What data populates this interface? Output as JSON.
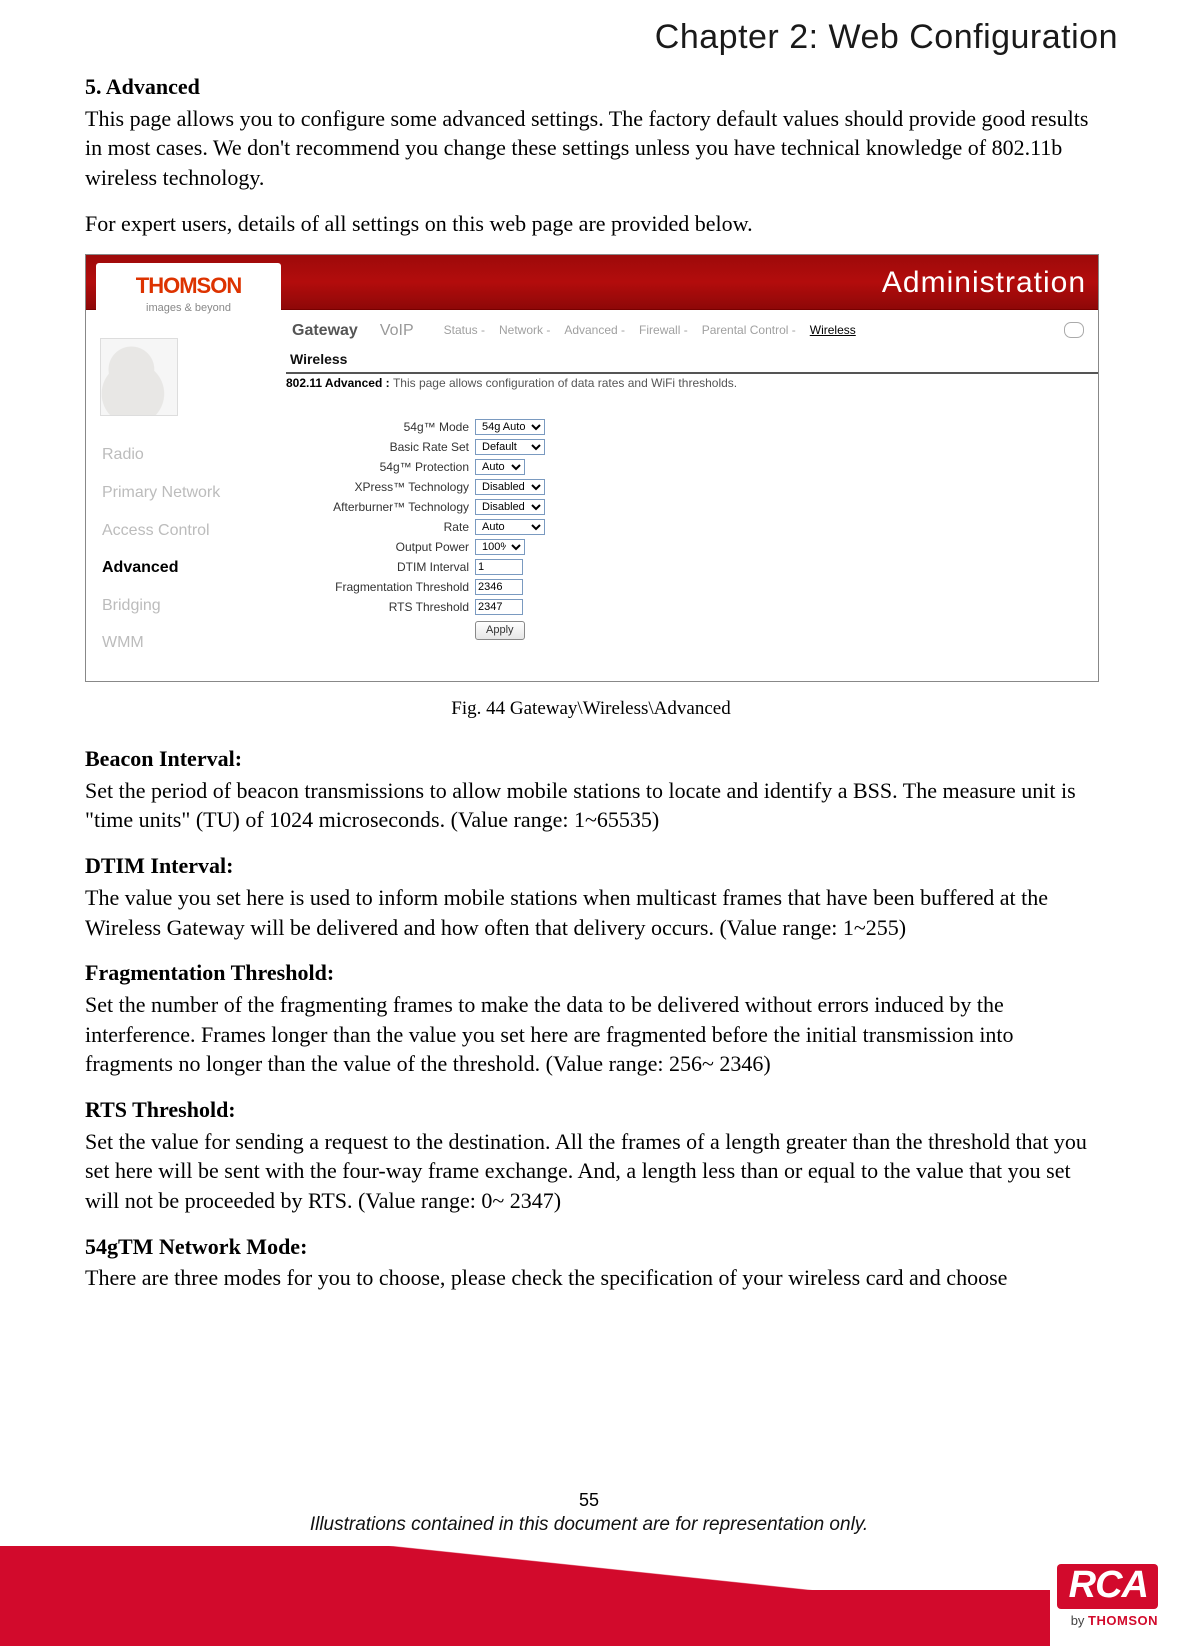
{
  "chapter_title": "Chapter 2: Web Configuration",
  "section5": {
    "heading": "5. Advanced",
    "p1": "This page allows you to configure some advanced settings. The factory default values should provide good results in most cases. We don't recommend you change these settings unless you have technical knowledge of 802.11b wireless technology.",
    "p2": "For expert users, details of all settings on this web page are provided below."
  },
  "screenshot": {
    "logo_brand": "THOMSON",
    "logo_sub": "images & beyond",
    "admin_label": "Administration",
    "tabs": {
      "gateway": "Gateway",
      "voip": "VoIP"
    },
    "menu": {
      "status": "Status -",
      "network": "Network -",
      "advanced": "Advanced -",
      "firewall": "Firewall -",
      "parental": "Parental Control -",
      "wireless": "Wireless"
    },
    "subheader": "Wireless",
    "desc_prefix": "802.11 Advanced : ",
    "desc_body": "This page allows configuration of data rates and WiFi thresholds.",
    "sidebar": {
      "items": [
        "Radio",
        "Primary Network",
        "Access Control",
        "Advanced",
        "Bridging",
        "WMM"
      ],
      "active": "Advanced"
    },
    "form": {
      "mode54g": {
        "label": "54g™ Mode",
        "value": "54g Auto"
      },
      "basic_rate": {
        "label": "Basic Rate Set",
        "value": "Default"
      },
      "protection": {
        "label": "54g™ Protection",
        "value": "Auto"
      },
      "xpress": {
        "label": "XPress™ Technology",
        "value": "Disabled"
      },
      "afterburner": {
        "label": "Afterburner™ Technology",
        "value": "Disabled"
      },
      "rate": {
        "label": "Rate",
        "value": "Auto"
      },
      "output_power": {
        "label": "Output Power",
        "value": "100%"
      },
      "dtim": {
        "label": "DTIM Interval",
        "value": "1"
      },
      "frag": {
        "label": "Fragmentation Threshold",
        "value": "2346"
      },
      "rts": {
        "label": "RTS Threshold",
        "value": "2347"
      },
      "apply": "Apply"
    }
  },
  "fig_caption": "Fig. 44 Gateway\\Wireless\\Advanced",
  "definitions": {
    "beacon": {
      "title": "Beacon Interval:",
      "body": "Set the period of beacon transmissions to allow mobile stations to locate and identify a BSS. The measure unit is \"time units\" (TU) of 1024 microseconds. (Value range: 1~65535)"
    },
    "dtim": {
      "title": "DTIM Interval:",
      "body": "The value you set here is used to inform mobile stations when multicast frames that have been buffered at the Wireless Gateway will be delivered and how often that delivery occurs. (Value range: 1~255)"
    },
    "frag": {
      "title": "Fragmentation Threshold:",
      "body": "Set the number of the fragmenting frames to make the data to be delivered without errors induced by the interference. Frames longer than the value you set here are fragmented before the initial transmission into fragments no longer than the value of the threshold. (Value range: 256~ 2346)"
    },
    "rts": {
      "title": "RTS Threshold:",
      "body": "Set the value for sending a request to the destination. All the frames of a length greater than the threshold that you set here will be sent with the four-way frame exchange. And, a length less than or equal to the value that you set will not be proceeded by RTS. (Value range: 0~ 2347)"
    },
    "mode54g": {
      "title": "54gTM Network Mode:",
      "body": "There are three modes for you to choose, please check the specification of your wireless card and choose"
    }
  },
  "footer": {
    "page_num": "55",
    "note": "Illustrations contained in this document are for representation only.",
    "rca": "RCA",
    "by": "by",
    "thomson": "THOMSON"
  }
}
